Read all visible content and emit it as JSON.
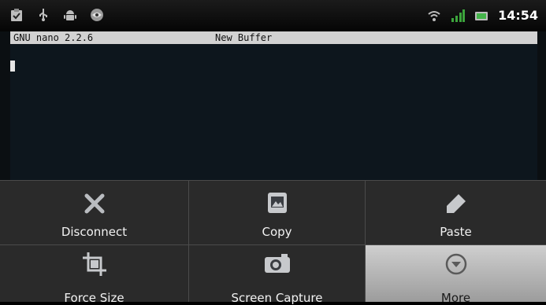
{
  "status_bar": {
    "time": "14:54",
    "left_icons": [
      "clipboard-check-icon",
      "usb-icon",
      "android-icon",
      "eye-icon"
    ],
    "right_icons": [
      "wifi-icon",
      "signal-icon",
      "battery-icon"
    ]
  },
  "editor": {
    "version": "GNU nano 2.2.6",
    "buffer_title": "New Buffer"
  },
  "menu": {
    "items": [
      {
        "label": "Disconnect",
        "icon": "close-icon"
      },
      {
        "label": "Copy",
        "icon": "image-icon"
      },
      {
        "label": "Paste",
        "icon": "pencil-icon"
      },
      {
        "label": "Force Size",
        "icon": "crop-icon"
      },
      {
        "label": "Screen Capture",
        "icon": "camera-icon"
      },
      {
        "label": "More",
        "icon": "chevron-down-circle-icon"
      }
    ]
  },
  "colors": {
    "editor_bg": "#0d161d",
    "header_bar": "#d2d2d2",
    "menu_bg": "#2a2a2a",
    "menu_selected": "#b5b5b5",
    "battery_green": "#44b44a"
  }
}
